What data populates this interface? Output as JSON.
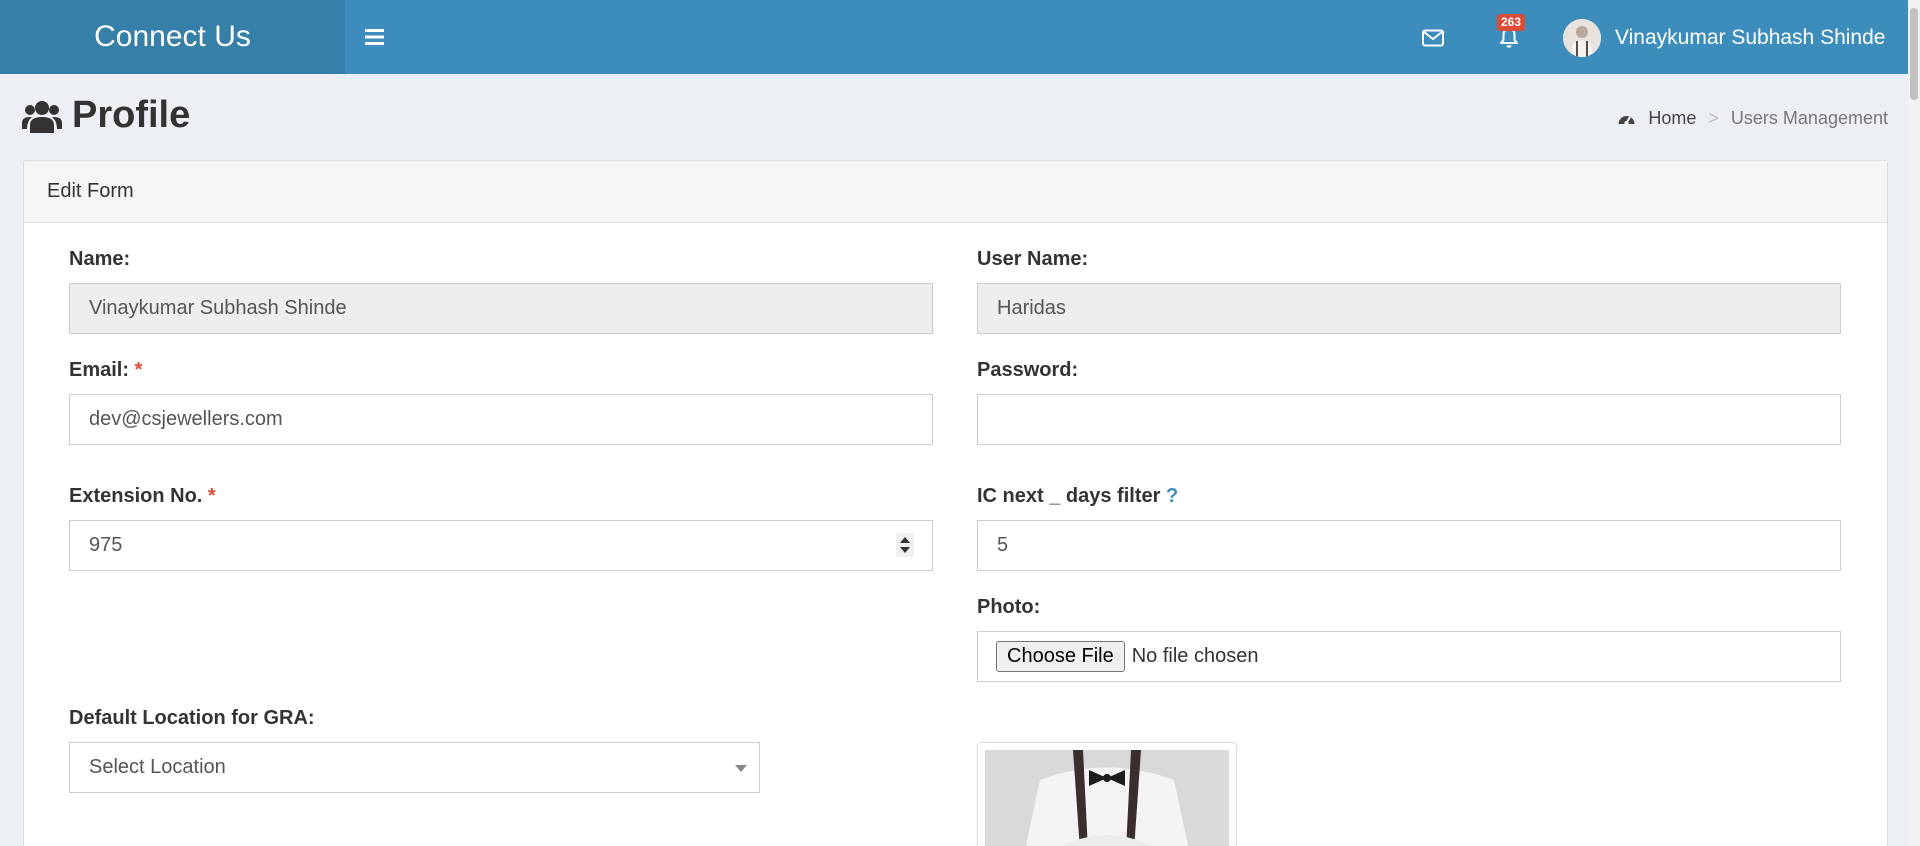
{
  "app": {
    "title": "Connect Us"
  },
  "topbar": {
    "notification_count": "263",
    "user_name": "Vinaykumar Subhash Shinde",
    "icons": {
      "menu": "hamburger-icon",
      "mail": "envelope-icon",
      "notifications": "bell-icon"
    }
  },
  "page": {
    "title": "Profile",
    "title_icon": "users-icon",
    "breadcrumb": {
      "home": "Home",
      "separator": ">",
      "current": "Users Management"
    }
  },
  "form": {
    "title": "Edit Form",
    "name_label": "Name:",
    "name_value": "Vinaykumar Subhash Shinde",
    "username_label": "User Name:",
    "username_value": "Haridas",
    "email_label": "Email:",
    "email_value": "dev@csjewellers.com",
    "password_label": "Password:",
    "password_value": "",
    "extension_label": "Extension No.",
    "extension_value": "975",
    "ic_filter_label": "IC next _ days filter",
    "ic_filter_help": "?",
    "ic_filter_value": "5",
    "photo_label": "Photo:",
    "file_button": "Choose File",
    "file_status": "No file chosen",
    "location_label": "Default Location for GRA:",
    "location_value": "Select Location",
    "required_mark": "*"
  },
  "colors": {
    "header": "#3c8dbc",
    "logo_bg": "#367fa9",
    "required": "#dd4b39",
    "badge": "#dd4b39",
    "page_bg": "#ecf0f5"
  }
}
